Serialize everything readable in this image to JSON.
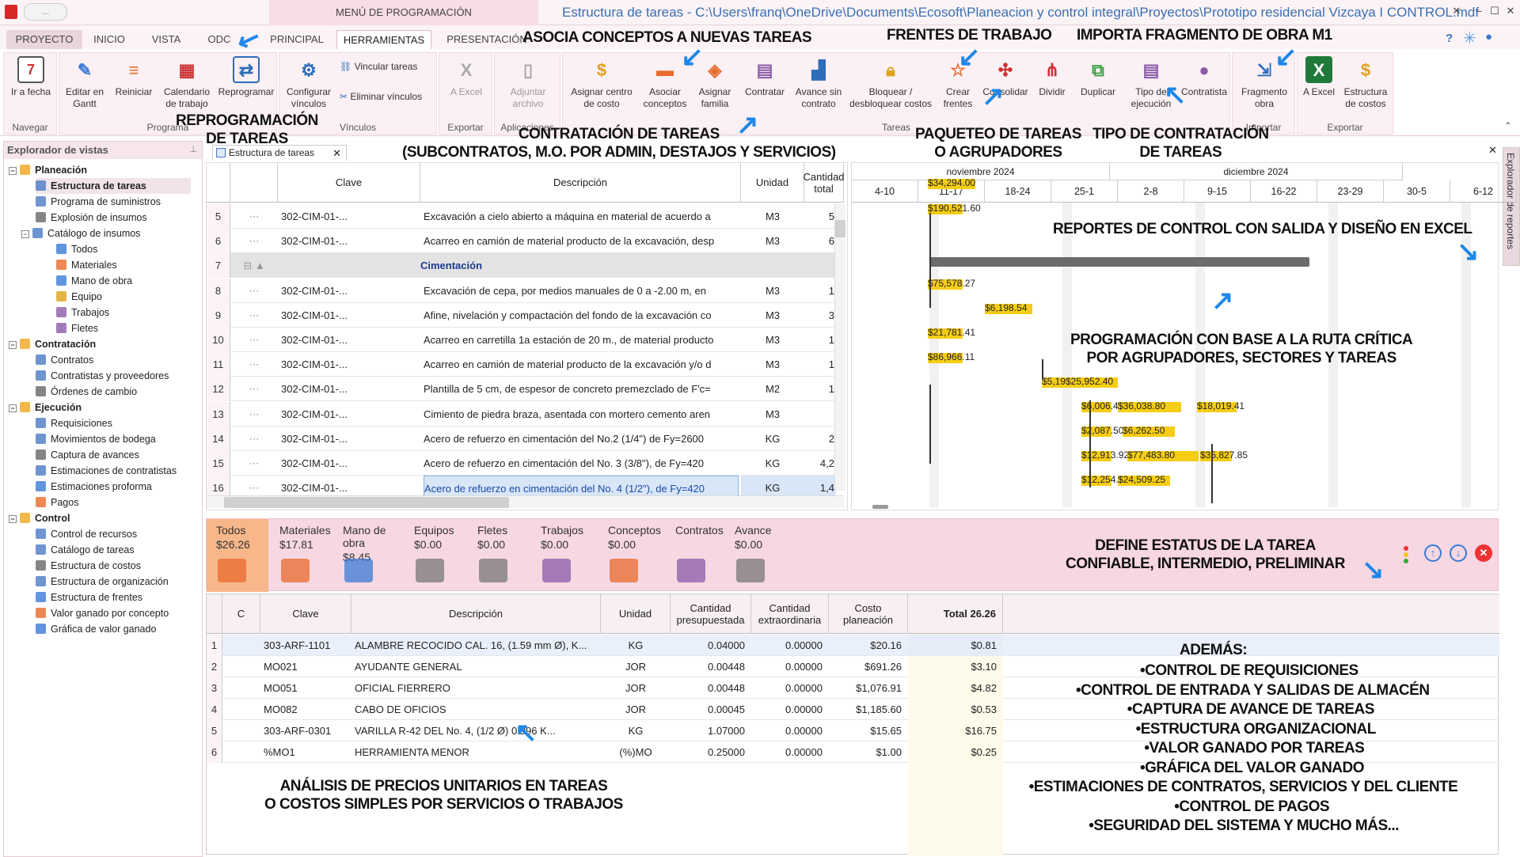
{
  "titlebar": {
    "menu_label": "MENÚ DE PROGRAMACIÓN",
    "title": "Estructura de tareas - C:\\Users\\franq\\OneDrive\\Documents\\Ecosoft\\Planeacion y control integral\\Proyectos\\Prototipo residencial Vizcaya I CONTROL.mdf",
    "qat": "...",
    "controls": [
      "✕",
      "–",
      "☐",
      "✕"
    ]
  },
  "tabs": [
    "PROYECTO",
    "INICIO",
    "VISTA",
    "ODC",
    "PRINCIPAL",
    "HERRAMIENTAS",
    "PRESENTACIÓN"
  ],
  "ribbon": {
    "navegar": {
      "label": "Navegar",
      "btn": "Ir a fecha"
    },
    "programa": {
      "label": "Programa",
      "btns": [
        "Editar en Gantt",
        "Reiniciar",
        "Calendario de trabajo",
        "Reprogramar"
      ]
    },
    "vinculos": {
      "label": "Vínculos",
      "btn": "Configurar vínculos",
      "small": [
        "Vincular tareas",
        "Eliminar vínculos"
      ]
    },
    "exportar": {
      "label": "Exportar",
      "btn": "A Excel"
    },
    "aplicaciones": {
      "label": "Aplicaciones",
      "btn": "Adjuntar archivo"
    },
    "tareas": {
      "label": "Tareas",
      "btns": [
        "Asignar centro de costo",
        "Asociar conceptos",
        "Asignar familia",
        "Contratar",
        "Avance sin contrato",
        "Bloquear / desbloquear costos",
        "Crear frentes",
        "Consolidar",
        "Dividir",
        "Duplicar",
        "Tipo de ejecución",
        "Contratista"
      ]
    },
    "importar": {
      "label": "Importar",
      "btn": "Fragmento obra"
    },
    "exportar2": {
      "label": "Exportar",
      "btns": [
        "A Excel",
        "Estructura de costos"
      ]
    }
  },
  "annotations": {
    "asocia": "ASOCIA CONCEPTOS A NUEVAS TAREAS",
    "frentes": "FRENTES DE TRABAJO",
    "importa": "IMPORTA FRAGMENTO DE OBRA M1",
    "reprog": "REPROGRAMACIÓN\nDE TAREAS",
    "contratacion": "CONTRATACIÓN DE TAREAS\n(SUBCONTRATOS, M.O. POR ADMIN, DESTAJOS Y SERVICIOS)",
    "paqueteo": "PAQUETEO DE TAREAS\nO AGRUPADORES",
    "tipo": "TIPO DE CONTRATACIÓN\nDE TAREAS",
    "reportes": "REPORTES DE CONTROL CON SALIDA Y DISEÑO EN EXCEL",
    "ruta": "PROGRAMACIÓN CON BASE A LA RUTA CRÍTICA\nPOR AGRUPADORES, SECTORES Y TAREAS",
    "estatus": "DEFINE ESTATUS DE LA TAREA\nCONFIABLE, INTERMEDIO, PRELIMINAR",
    "apu": "ANÁLISIS DE PRECIOS UNITARIOS EN TAREAS\nO COSTOS SIMPLES POR SERVICIOS O TRABAJOS",
    "ademas_title": "ADEMÁS:",
    "ademas": [
      "•CONTROL DE REQUISICIONES",
      "•CONTROL DE ENTRADA Y SALIDAS DE ALMACÉN",
      "•CAPTURA DE AVANCE DE TAREAS",
      "•ESTRUCTURA ORGANIZACIONAL",
      "•VALOR GANADO POR TAREAS",
      "•GRÁFICA DEL VALOR GANADO",
      "•ESTIMACIONES DE CONTRATOS, SERVICIOS Y DEL CLIENTE",
      "•CONTROL DE PAGOS",
      "•SEGURIDAD DEL SISTEMA Y MUCHO MÁS..."
    ]
  },
  "sidebar": {
    "title": "Explorador de vistas",
    "sections": [
      {
        "label": "Planeación",
        "items": [
          "Estructura de tareas",
          "Programa de suministros",
          "Explosión de insumos",
          "Catálogo de insumos",
          "Todos",
          "Materiales",
          "Mano de obra",
          "Equipo",
          "Trabajos",
          "Fletes"
        ]
      },
      {
        "label": "Contratación",
        "items": [
          "Contratos",
          "Contratistas y proveedores",
          "Órdenes de cambio"
        ]
      },
      {
        "label": "Ejecución",
        "items": [
          "Requisiciones",
          "Movimientos de bodega",
          "Captura de avances",
          "Estimaciones de contratistas",
          "Estimaciones proforma",
          "Pagos"
        ]
      },
      {
        "label": "Control",
        "items": [
          "Control de recursos",
          "Catálogo de tareas",
          "Estructura de costos",
          "Estructura de organización",
          "Estructura de frentes",
          "Valor ganado por concepto",
          "Gráfica de valor ganado"
        ]
      }
    ]
  },
  "doc_tab": "Estructura de tareas",
  "right_panel": "Explorador de reportes",
  "grid": {
    "headers": [
      "Clave",
      "Descripción",
      "Unidad",
      "Cantidad total"
    ],
    "rows": [
      {
        "n": "5",
        "clave": "302-CIM-01-...",
        "desc": "Excavación a cielo abierto a máquina en material de acuerdo a",
        "unidad": "M3",
        "cant": "5"
      },
      {
        "n": "6",
        "clave": "302-CIM-01-...",
        "desc": "Acarreo en camión de material producto de la excavación, desp",
        "unidad": "M3",
        "cant": "6"
      },
      {
        "n": "7",
        "clave": "",
        "desc": "Cimentación",
        "unidad": "",
        "cant": ""
      },
      {
        "n": "8",
        "clave": "302-CIM-01-...",
        "desc": "Excavación de cepa, por medios manuales de 0 a -2.00 m, en",
        "unidad": "M3",
        "cant": "1"
      },
      {
        "n": "9",
        "clave": "302-CIM-01-...",
        "desc": "Afine, nivelación y compactación del fondo de la excavación co",
        "unidad": "M3",
        "cant": "3"
      },
      {
        "n": "10",
        "clave": "302-CIM-01-...",
        "desc": "Acarreo en carretilla 1a estación de 20 m., de material producto",
        "unidad": "M3",
        "cant": "1"
      },
      {
        "n": "11",
        "clave": "302-CIM-01-...",
        "desc": "Acarreo en camión de material producto de la excavación y/o d",
        "unidad": "M3",
        "cant": "1"
      },
      {
        "n": "12",
        "clave": "302-CIM-01-...",
        "desc": "Plantilla de 5 cm, de espesor de concreto premezclado de F'c=",
        "unidad": "M2",
        "cant": "1"
      },
      {
        "n": "13",
        "clave": "302-CIM-01-...",
        "desc": "Cimiento de piedra braza, asentada con mortero cemento aren",
        "unidad": "M3",
        "cant": ""
      },
      {
        "n": "14",
        "clave": "302-CIM-01-...",
        "desc": "Acero de refuerzo en cimentación del No.2 (1/4\") de  Fy=2600",
        "unidad": "KG",
        "cant": "2"
      },
      {
        "n": "15",
        "clave": "302-CIM-01-...",
        "desc": "Acero de refuerzo en cimentación del No. 3 (3/8\"), de  Fy=420",
        "unidad": "KG",
        "cant": "4,2"
      },
      {
        "n": "16",
        "clave": "302-CIM-01-...",
        "desc": "Acero de refuerzo en cimentación del No. 4 (1/2\"), de  Fy=420",
        "unidad": "KG",
        "cant": "1,4"
      }
    ]
  },
  "gantt": {
    "months": [
      "noviembre 2024",
      "diciembre 2024"
    ],
    "weeks": [
      "4-10",
      "11-17",
      "18-24",
      "25-1",
      "2-8",
      "9-15",
      "16-22",
      "23-29",
      "30-5",
      "6-12"
    ],
    "labels": [
      "$34,294.00",
      "$190,521.60",
      "$75,578.27",
      "$6,198.54",
      "$21,781.41",
      "$86,966.11",
      "$5,191.10",
      "$25,952.40",
      "$6,006.47",
      "$36,038.80",
      "$18,019.41",
      "$2,087.50",
      "$6,262.50",
      "$12,913.92",
      "$77,483.80",
      "$35,827.85",
      "$12,254.75",
      "$24,509.25"
    ]
  },
  "restabs": [
    {
      "label": "Todos",
      "value": "$26.26"
    },
    {
      "label": "Materiales",
      "value": "$17.81"
    },
    {
      "label": "Mano de obra",
      "value": "$8.45"
    },
    {
      "label": "Equipos",
      "value": "$0.00"
    },
    {
      "label": "Fletes",
      "value": "$0.00"
    },
    {
      "label": "Trabajos",
      "value": "$0.00"
    },
    {
      "label": "Conceptos",
      "value": "$0.00"
    },
    {
      "label": "Contratos",
      "value": ""
    },
    {
      "label": "Avance",
      "value": "$0.00"
    }
  ],
  "lgrid": {
    "headers": [
      "C",
      "Clave",
      "Descripción",
      "Unidad",
      "Cantidad presupuestada",
      "Cantidad extraordinaria",
      "Costo planeación",
      "Total 26.26"
    ],
    "rows": [
      {
        "n": "1",
        "clave": "303-ARF-1101",
        "desc": "ALAMBRE RECOCIDO CAL. 16, (1.59 mm Ø), K...",
        "unidad": "KG",
        "cp": "0.04000",
        "ce": "0.00000",
        "costo": "$20.16",
        "total": "$0.81"
      },
      {
        "n": "2",
        "clave": "MO021",
        "desc": "AYUDANTE GENERAL",
        "unidad": "JOR",
        "cp": "0.00448",
        "ce": "0.00000",
        "costo": "$691.26",
        "total": "$3.10"
      },
      {
        "n": "3",
        "clave": "MO051",
        "desc": "OFICIAL FIERRERO",
        "unidad": "JOR",
        "cp": "0.00448",
        "ce": "0.00000",
        "costo": "$1,076.91",
        "total": "$4.82"
      },
      {
        "n": "4",
        "clave": "MO082",
        "desc": "CABO DE OFICIOS",
        "unidad": "JOR",
        "cp": "0.00045",
        "ce": "0.00000",
        "costo": "$1,185.60",
        "total": "$0.53"
      },
      {
        "n": "5",
        "clave": "303-ARF-0301",
        "desc": "VARILLA R-42 DEL No. 4, (1/2 Ø)      0.996 K...",
        "unidad": "KG",
        "cp": "1.07000",
        "ce": "0.00000",
        "costo": "$15.65",
        "total": "$16.75"
      },
      {
        "n": "6",
        "clave": "%MO1",
        "desc": "HERRAMIENTA MENOR",
        "unidad": "(%)MO",
        "cp": "0.25000",
        "ce": "0.00000",
        "costo": "$1.00",
        "total": "$0.25"
      }
    ]
  }
}
